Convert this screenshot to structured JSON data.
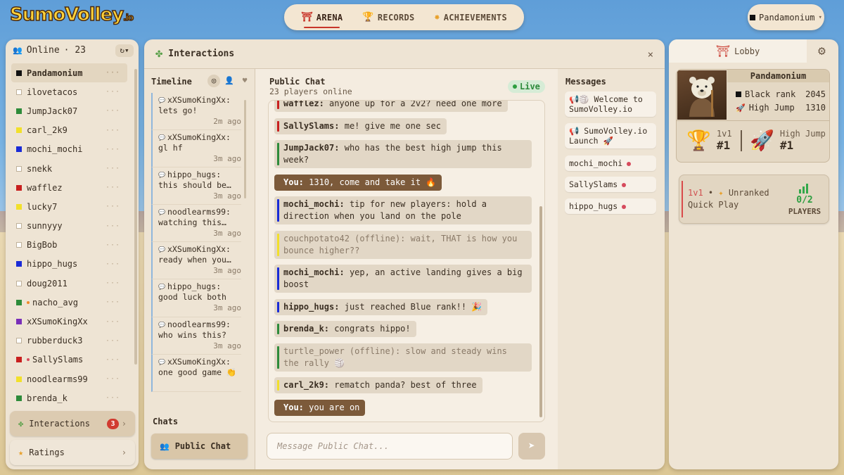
{
  "logo": {
    "text": "SumoVolley",
    "suffix": ".io"
  },
  "nav": {
    "tabs": [
      {
        "label": "ARENA",
        "icon": "⛩",
        "active": true
      },
      {
        "label": "RECORDS",
        "icon": "🏆",
        "active": false
      },
      {
        "label": "ACHIEVEMENTS",
        "icon": "✸",
        "active": false
      }
    ]
  },
  "user": {
    "name": "Pandamonium",
    "rank_color": "#111111"
  },
  "online": {
    "label": "Online",
    "count": "· 23",
    "refresh": "↻▾"
  },
  "players": [
    {
      "name": "Pandamonium",
      "color": "#111111"
    },
    {
      "name": "ilovetacos",
      "color": "#ffffff"
    },
    {
      "name": "JumpJack07",
      "color": "#2e8b3a"
    },
    {
      "name": "carl_2k9",
      "color": "#f2e02a"
    },
    {
      "name": "mochi_mochi",
      "color": "#1a2bd6"
    },
    {
      "name": "snekk",
      "color": "#ffffff"
    },
    {
      "name": "wafflez",
      "color": "#c8201f"
    },
    {
      "name": "lucky7",
      "color": "#f2e02a"
    },
    {
      "name": "sunnyyy",
      "color": "#ffffff"
    },
    {
      "name": "BigBob",
      "color": "#ffffff"
    },
    {
      "name": "hippo_hugs",
      "color": "#1a2bd6"
    },
    {
      "name": "doug2011",
      "color": "#ffffff"
    },
    {
      "name": "nacho_avg",
      "color": "#2e8b3a",
      "status_dot": "#f08a2a"
    },
    {
      "name": "xXSumoKingXx",
      "color": "#7a2fb8"
    },
    {
      "name": "rubberduck3",
      "color": "#ffffff"
    },
    {
      "name": "SallySlams",
      "color": "#c8201f",
      "status_dot": "#d64a5c"
    },
    {
      "name": "noodlearms99",
      "color": "#f2e02a"
    },
    {
      "name": "brenda_k",
      "color": "#2e8b3a"
    }
  ],
  "left_buttons": {
    "interactions": "Interactions",
    "interactions_badge": "3",
    "ratings": "Ratings"
  },
  "panel": {
    "title": "Interactions",
    "close": "×"
  },
  "timeline": {
    "title": "Timeline",
    "items": [
      {
        "user": "xXSumoKingXx:",
        "text": "lets go!",
        "time": "2m ago"
      },
      {
        "user": "xXSumoKingXx:",
        "text": "gl hf",
        "time": "3m ago"
      },
      {
        "user": "hippo_hugs:",
        "text": "this should be…",
        "time": "3m ago"
      },
      {
        "user": "noodlearms99:",
        "text": "watching this…",
        "time": "3m ago"
      },
      {
        "user": "xXSumoKingXx:",
        "text": "ready when you…",
        "time": "3m ago"
      },
      {
        "user": "hippo_hugs:",
        "text": "good luck both",
        "time": "3m ago"
      },
      {
        "user": "noodlearms99:",
        "text": "who wins this?",
        "time": "3m ago"
      },
      {
        "user": "xXSumoKingXx:",
        "text": "one good game 👏",
        "time": ""
      }
    ]
  },
  "chats": {
    "label": "Chats",
    "public_btn": "Public Chat"
  },
  "chat": {
    "title": "Public Chat",
    "subtitle": "23 players online",
    "live": "Live",
    "placeholder": "Message Public Chat...",
    "send": "➤",
    "messages": [
      {
        "user": "wafflez:",
        "text": "anyone up for a 2v2? need one more",
        "color": "#c8201f",
        "kind": "normal"
      },
      {
        "user": "SallySlams:",
        "text": "me! give me one sec",
        "color": "#c8201f",
        "kind": "normal"
      },
      {
        "user": "JumpJack07:",
        "text": "who has the best high jump this week?",
        "color": "#2e8b3a",
        "kind": "normal"
      },
      {
        "user": "You:",
        "text": "1310, come and take it 🔥",
        "color": "#111111",
        "kind": "you"
      },
      {
        "user": "mochi_mochi:",
        "text": "tip for new players: hold a direction when you land on the pole",
        "color": "#1a2bd6",
        "kind": "normal"
      },
      {
        "user": "couchpotato42 (offline):",
        "text": "wait, THAT is how you bounce higher??",
        "color": "#f2e02a",
        "kind": "off"
      },
      {
        "user": "mochi_mochi:",
        "text": "yep, an active landing gives a big boost",
        "color": "#1a2bd6",
        "kind": "normal"
      },
      {
        "user": "hippo_hugs:",
        "text": "just reached Blue rank!! 🎉",
        "color": "#1a2bd6",
        "kind": "normal"
      },
      {
        "user": "brenda_k:",
        "text": "congrats hippo!",
        "color": "#2e8b3a",
        "kind": "normal"
      },
      {
        "user": "turtle_power (offline):",
        "text": "slow and steady wins the rally 🏐",
        "color": "#2e8b3a",
        "kind": "off"
      },
      {
        "user": "carl_2k9:",
        "text": "rematch panda? best of three",
        "color": "#f2e02a",
        "kind": "normal"
      },
      {
        "user": "You:",
        "text": "you are on",
        "color": "#111111",
        "kind": "you"
      }
    ]
  },
  "messages": {
    "title": "Messages",
    "items": [
      {
        "text": "📢🏐 Welcome to SumoVolley.io",
        "unread": false
      },
      {
        "text": "📢 SumoVolley.io Launch 🚀",
        "unread": false
      },
      {
        "text": "mochi_mochi",
        "unread": true
      },
      {
        "text": "SallySlams",
        "unread": true
      },
      {
        "text": "hippo_hugs",
        "unread": true
      }
    ]
  },
  "lobby": {
    "tab": "Lobby",
    "tab_icon": "⛩",
    "gear": "⚙",
    "player": {
      "name": "Pandamonium",
      "rank_label": "Black rank",
      "rank_value": "2045",
      "jump_label": "High Jump",
      "jump_value": "1310"
    },
    "stat1": {
      "label": "1v1",
      "value": "#1",
      "icon": "🏆"
    },
    "stat2": {
      "label": "High Jump",
      "value": "#1",
      "icon": "🚀"
    },
    "queue": {
      "mode": "1v1",
      "sep": "•",
      "type": "Unranked",
      "name": "Quick Play",
      "players": "0/2",
      "players_label": "PLAYERS"
    }
  },
  "colors": {
    "accent": "#c8352a",
    "live": "#2d9e40",
    "you_bubble": "#7c5a3a"
  }
}
